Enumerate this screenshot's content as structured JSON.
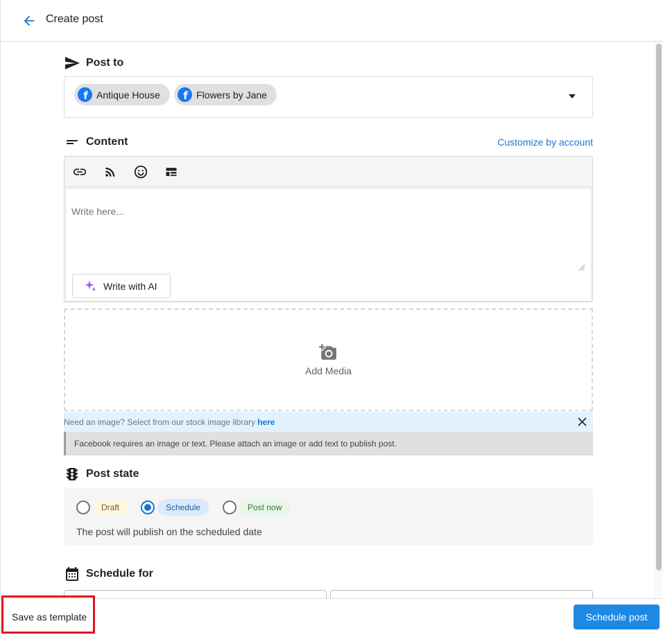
{
  "header": {
    "title": "Create post",
    "back_icon": "arrow-left-icon"
  },
  "post_to": {
    "title": "Post to",
    "icon": "send-icon",
    "accounts": [
      {
        "name": "Antique House",
        "icon": "facebook-icon"
      },
      {
        "name": "Flowers by Jane",
        "icon": "facebook-icon"
      }
    ]
  },
  "content": {
    "title": "Content",
    "icon": "short-text-icon",
    "customize_label": "Customize by account",
    "toolbar": [
      "link-icon",
      "rss-icon",
      "emoji-icon",
      "template-icon"
    ],
    "placeholder": "Write here...",
    "ai_button_label": "Write with AI"
  },
  "media": {
    "label": "Add Media",
    "icon": "add-photo-icon",
    "stock_text": "Need an image? Select from our stock image library",
    "stock_link": "here",
    "warning": "Facebook requires an image or text. Please attach an image or add text to publish post."
  },
  "post_state": {
    "title": "Post state",
    "icon": "traffic-light-icon",
    "options": [
      {
        "label": "Draft",
        "selected": false
      },
      {
        "label": "Schedule",
        "selected": true
      },
      {
        "label": "Post now",
        "selected": false
      }
    ],
    "description": "The post will publish on the scheduled date"
  },
  "schedule": {
    "title": "Schedule for",
    "icon": "calendar-icon"
  },
  "footer": {
    "save_template_label": "Save as template",
    "schedule_button_label": "Schedule post"
  },
  "colors": {
    "accent": "#1976d2",
    "facebook": "#1877f2",
    "highlight": "#e0141e"
  }
}
